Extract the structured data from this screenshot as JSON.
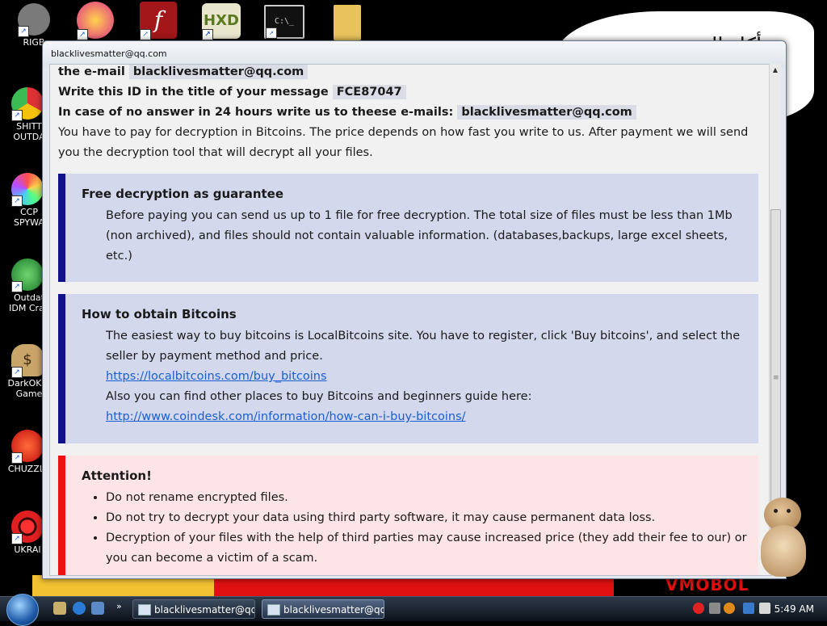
{
  "window": {
    "title": "blacklivesmatter@qq.com"
  },
  "note": {
    "email_label": "the e-mail",
    "email_value": "blacklivesmatter@qq.com",
    "id_label": "Write this ID in the title of your message",
    "id_value": "FCE87047",
    "no_answer_label": "In case of no answer in 24 hours write us to theese e-mails:",
    "no_answer_email": "blacklivesmatter@qq.com",
    "payment_text": "You have to pay for decryption in Bitcoins. The price depends on how fast you write to us. After payment we will send you the decryption tool that will decrypt all your files."
  },
  "free_box": {
    "title": "Free decryption as guarantee",
    "body": "Before paying you can send us up to 1 file for free decryption. The total size of files must be less than 1Mb (non archived), and files should not contain valuable information. (databases,backups, large excel sheets, etc.)"
  },
  "bitcoin_box": {
    "title": "How to obtain Bitcoins",
    "body": "The easiest way to buy bitcoins is LocalBitcoins site. You have to register, click 'Buy bitcoins', and select the seller by payment method and price.",
    "link1": "https://localbitcoins.com/buy_bitcoins",
    "body2": "Also you can find other places to buy Bitcoins and beginners guide here:",
    "link2": "http://www.coindesk.com/information/how-can-i-buy-bitcoins/"
  },
  "attention_box": {
    "title": "Attention!",
    "items": [
      "Do not rename encrypted files.",
      "Do not try to decrypt your data using third party software, it may cause permanent data loss.",
      "Decryption of your files with the help of third parties may cause increased price (they add their fee to our) or you can become a victim of a scam."
    ]
  },
  "desktop": {
    "icons": [
      {
        "label": "RIGB",
        "icon": "raccoon-icon"
      },
      {
        "label": "SHITT OUTDA",
        "icon": "chrome-icon"
      },
      {
        "label": "CCP SPYWA",
        "icon": "ccp-icon"
      },
      {
        "label": "Outdat IDM Crac",
        "icon": "idm-icon"
      },
      {
        "label": "DarkOK V Game",
        "icon": "money-bag-icon"
      },
      {
        "label": "CHUZZLI",
        "icon": "chuzzle-icon"
      },
      {
        "label": "UKRAI",
        "icon": "radiation-icon"
      }
    ],
    "background_text": "...أكل التي",
    "background_tag": "VMOBOL"
  },
  "taskbar": {
    "buttons": [
      {
        "label": "blacklivesmatter@qq..."
      },
      {
        "label": "blacklivesmatter@qq..."
      }
    ],
    "clock": "5:49 AM"
  },
  "colors": {
    "blue_bar": "#11118a",
    "blue_box": "#d3d8ec",
    "red_bar": "#ee1111",
    "red_box": "#fde4e6",
    "link": "#1a5fcf"
  }
}
